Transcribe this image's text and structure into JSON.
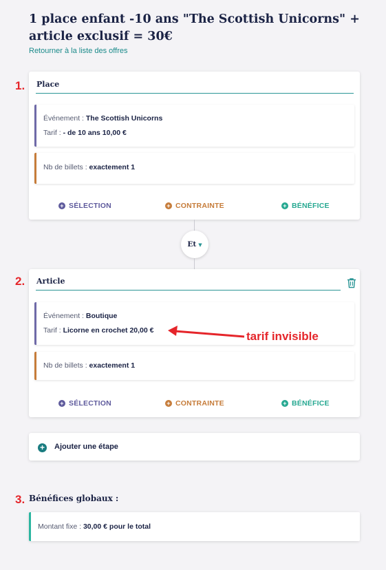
{
  "page": {
    "title": "1 place enfant -10 ans \"The Scottish Unicorns\" + article exclusif = 30€",
    "back_link": "Retourner à la liste des offres"
  },
  "steps": [
    {
      "number": "1.",
      "title": "Place",
      "event_label": "Événement : ",
      "event_value": "The Scottish Unicorns",
      "tarif_label": "Tarif : ",
      "tarif_value": "- de 10 ans 10,00 €",
      "tickets_label": "Nb de billets : ",
      "tickets_value": "exactement 1"
    },
    {
      "number": "2.",
      "title": "Article",
      "event_label": "Événement : ",
      "event_value": "Boutique",
      "tarif_label": "Tarif : ",
      "tarif_value": "Licorne en crochet 20,00 €",
      "tickets_label": "Nb de billets : ",
      "tickets_value": "exactement 1"
    }
  ],
  "actions": {
    "selection": "SÉLECTION",
    "contrainte": "CONTRAINTE",
    "benefice": "BÉNÉFICE"
  },
  "connector": {
    "label": "Et"
  },
  "add_step": {
    "label": "Ajouter une étape"
  },
  "global": {
    "number": "3.",
    "title": "Bénéfices globaux :",
    "label": "Montant fixe : ",
    "value": "30,00 € pour le total"
  },
  "annotation": {
    "text": "tarif invisible",
    "color": "#e5252a"
  },
  "colors": {
    "selection": "#5e5a9c",
    "contrainte": "#c67c3a",
    "benefice": "#26a891",
    "accent": "#2a9595"
  },
  "icons": [
    "plus-circle-icon",
    "chevron-down-icon",
    "trash-icon",
    "arrow-left-icon"
  ]
}
